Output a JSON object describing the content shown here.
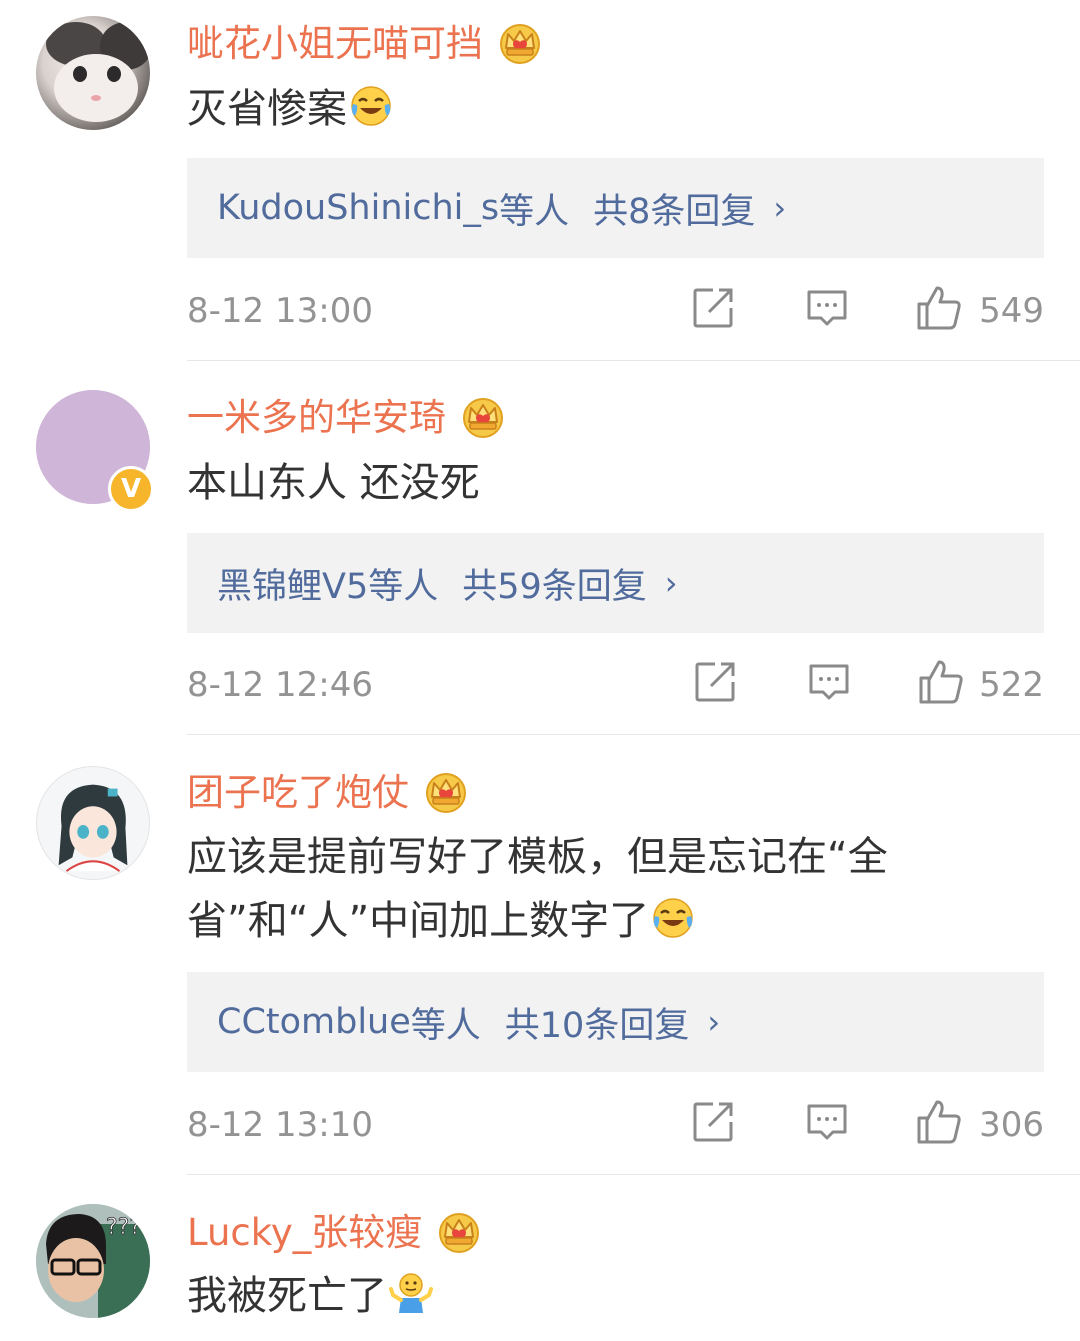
{
  "comments": [
    {
      "username": "呲花小姐无喵可挡",
      "text": "灭省惨案",
      "reply_names": "KudouShinichi_s",
      "reply_suffix": "等人",
      "reply_count": "共8条回复",
      "time": "8-12 13:00",
      "likes": "549"
    },
    {
      "username": "一米多的华安琦",
      "text": "本山东人 还没死",
      "reply_names": "黑锦鲤V5",
      "reply_suffix": "等人",
      "reply_count": "共59条回复",
      "time": "8-12 12:46",
      "likes": "522"
    },
    {
      "username": "团子吃了炮仗",
      "text": "应该是提前写好了模板，但是忘记在“全省”和“人”中间加上数字了",
      "reply_names": "CCtomblue",
      "reply_suffix": "等人",
      "reply_count": "共10条回复",
      "time": "8-12 13:10",
      "likes": "306"
    },
    {
      "username": "Lucky_张较瘦",
      "text": "我被死亡了"
    }
  ],
  "icons": {
    "crown": "crown-badge-icon",
    "share": "share-icon",
    "comment": "comment-icon",
    "like": "thumbs-up-icon",
    "chevron": "chevron-right-icon"
  },
  "colors": {
    "username": "#eb7350",
    "link": "#506b9c",
    "meta": "#939393",
    "text": "#333333",
    "reply_bg": "#f2f2f2"
  },
  "chevron_glyph": "›"
}
